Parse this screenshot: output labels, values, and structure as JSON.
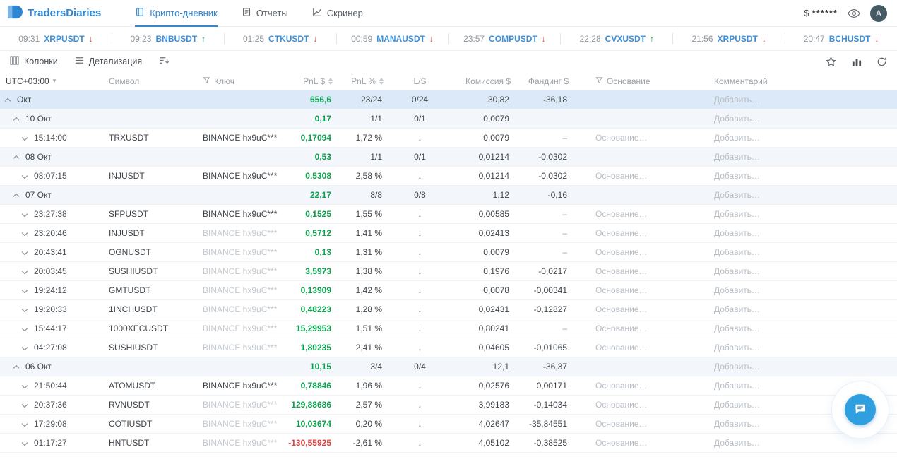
{
  "app": {
    "title": "TradersDiaries",
    "balance_currency": "$",
    "balance_masked": "******",
    "avatar_initial": "A"
  },
  "nav": {
    "tabs": [
      {
        "label": "Крипто-дневник",
        "active": true
      },
      {
        "label": "Отчеты",
        "active": false
      },
      {
        "label": "Скринер",
        "active": false
      }
    ]
  },
  "ticker": {
    "items": [
      {
        "time": "09:31",
        "symbol": "XRPUSDT",
        "direction": "down"
      },
      {
        "time": "09:23",
        "symbol": "BNBUSDT",
        "direction": "up"
      },
      {
        "time": "01:25",
        "symbol": "CTKUSDT",
        "direction": "down"
      },
      {
        "time": "00:59",
        "symbol": "MANAUSDT",
        "direction": "down"
      },
      {
        "time": "23:57",
        "symbol": "COMPUSDT",
        "direction": "down"
      },
      {
        "time": "22:28",
        "symbol": "CVXUSDT",
        "direction": "up"
      },
      {
        "time": "21:56",
        "symbol": "XRPUSDT",
        "direction": "down"
      },
      {
        "time": "20:47",
        "symbol": "BCHUSDT",
        "direction": "down"
      }
    ]
  },
  "toolbar": {
    "columns": "Колонки",
    "details": "Детализация"
  },
  "table": {
    "headers": {
      "time": "UTC+03:00",
      "symbol": "Символ",
      "key": "Ключ",
      "pnl_usd": "PnL $",
      "pnl_pct": "PnL %",
      "ls": "L/S",
      "fee": "Комиссия $",
      "funding": "Фандинг $",
      "basis": "Основание",
      "comment": "Комментарий"
    },
    "placeholders": {
      "basis": "Основание…",
      "comment": "Добавить…"
    },
    "rows": [
      {
        "kind": "month",
        "label": "Окт",
        "pnl": "656,6",
        "stat": "23/24",
        "ls": "0/24",
        "fee": "30,82",
        "funding": "-36,18"
      },
      {
        "kind": "date",
        "label": "10 Окт",
        "pnl": "0,17",
        "stat": "1/1",
        "ls": "0/1",
        "fee": "0,0079",
        "funding": ""
      },
      {
        "kind": "trade",
        "time": "15:14:00",
        "symbol": "TRXUSDT",
        "key": "BINANCE hx9uC***",
        "key_muted": false,
        "pnl": "0,17094",
        "pnl_neg": false,
        "pct": "1,72 %",
        "ls": "short",
        "fee": "0,0079",
        "funding": "–"
      },
      {
        "kind": "date",
        "label": "08 Окт",
        "pnl": "0,53",
        "stat": "1/1",
        "ls": "0/1",
        "fee": "0,01214",
        "funding": "-0,0302"
      },
      {
        "kind": "trade",
        "time": "08:07:15",
        "symbol": "INJUSDT",
        "key": "BINANCE hx9uC***",
        "key_muted": false,
        "pnl": "0,5308",
        "pnl_neg": false,
        "pct": "2,58 %",
        "ls": "short",
        "fee": "0,01214",
        "funding": "-0,0302"
      },
      {
        "kind": "date",
        "label": "07 Окт",
        "pnl": "22,17",
        "stat": "8/8",
        "ls": "0/8",
        "fee": "1,12",
        "funding": "-0,16"
      },
      {
        "kind": "trade",
        "time": "23:27:38",
        "symbol": "SFPUSDT",
        "key": "BINANCE hx9uC***",
        "key_muted": false,
        "pnl": "0,1525",
        "pnl_neg": false,
        "pct": "1,55 %",
        "ls": "short",
        "fee": "0,00585",
        "funding": "–"
      },
      {
        "kind": "trade",
        "time": "23:20:46",
        "symbol": "INJUSDT",
        "key": "BINANCE hx9uC***",
        "key_muted": true,
        "pnl": "0,5712",
        "pnl_neg": false,
        "pct": "1,41 %",
        "ls": "short",
        "fee": "0,02413",
        "funding": "–"
      },
      {
        "kind": "trade",
        "time": "20:43:41",
        "symbol": "OGNUSDT",
        "key": "BINANCE hx9uC***",
        "key_muted": true,
        "pnl": "0,13",
        "pnl_neg": false,
        "pct": "1,31 %",
        "ls": "short",
        "fee": "0,0079",
        "funding": "–"
      },
      {
        "kind": "trade",
        "time": "20:03:45",
        "symbol": "SUSHIUSDT",
        "key": "BINANCE hx9uC***",
        "key_muted": true,
        "pnl": "3,5973",
        "pnl_neg": false,
        "pct": "1,38 %",
        "ls": "short",
        "fee": "0,1976",
        "funding": "-0,0217"
      },
      {
        "kind": "trade",
        "time": "19:24:12",
        "symbol": "GMTUSDT",
        "key": "BINANCE hx9uC***",
        "key_muted": true,
        "pnl": "0,13909",
        "pnl_neg": false,
        "pct": "1,42 %",
        "ls": "short",
        "fee": "0,0078",
        "funding": "-0,00341"
      },
      {
        "kind": "trade",
        "time": "19:20:33",
        "symbol": "1INCHUSDT",
        "key": "BINANCE hx9uC***",
        "key_muted": true,
        "pnl": "0,48223",
        "pnl_neg": false,
        "pct": "1,28 %",
        "ls": "short",
        "fee": "0,02431",
        "funding": "-0,12827"
      },
      {
        "kind": "trade",
        "time": "15:44:17",
        "symbol": "1000XECUSDT",
        "key": "BINANCE hx9uC***",
        "key_muted": true,
        "pnl": "15,29953",
        "pnl_neg": false,
        "pct": "1,51 %",
        "ls": "short",
        "fee": "0,80241",
        "funding": "–"
      },
      {
        "kind": "trade",
        "time": "04:27:08",
        "symbol": "SUSHIUSDT",
        "key": "BINANCE hx9uC***",
        "key_muted": true,
        "pnl": "1,80235",
        "pnl_neg": false,
        "pct": "2,41 %",
        "ls": "short",
        "fee": "0,04605",
        "funding": "-0,01065"
      },
      {
        "kind": "date",
        "label": "06 Окт",
        "pnl": "10,15",
        "stat": "3/4",
        "ls": "0/4",
        "fee": "12,1",
        "funding": "-36,37"
      },
      {
        "kind": "trade",
        "time": "21:50:44",
        "symbol": "ATOMUSDT",
        "key": "BINANCE hx9uC***",
        "key_muted": false,
        "pnl": "0,78846",
        "pnl_neg": false,
        "pct": "1,96 %",
        "ls": "short",
        "fee": "0,02576",
        "funding": "0,00171"
      },
      {
        "kind": "trade",
        "time": "20:37:36",
        "symbol": "RVNUSDT",
        "key": "BINANCE hx9uC***",
        "key_muted": true,
        "pnl": "129,88686",
        "pnl_neg": false,
        "pct": "2,57 %",
        "ls": "short",
        "fee": "3,99183",
        "funding": "-0,14034"
      },
      {
        "kind": "trade",
        "time": "17:29:08",
        "symbol": "COTIUSDT",
        "key": "BINANCE hx9uC***",
        "key_muted": true,
        "pnl": "10,03674",
        "pnl_neg": false,
        "pct": "0,20 %",
        "ls": "short",
        "fee": "4,02647",
        "funding": "-35,84551"
      },
      {
        "kind": "trade",
        "time": "01:17:27",
        "symbol": "HNTUSDT",
        "key": "BINANCE hx9uC***",
        "key_muted": true,
        "pnl": "-130,55925",
        "pnl_neg": true,
        "pct": "-2,61 %",
        "ls": "short",
        "fee": "4,05102",
        "funding": "-0,38525"
      }
    ]
  },
  "colors": {
    "accent_blue": "#2f86d2",
    "positive_green": "#0da04f",
    "negative_red": "#e03e3e",
    "month_row_bg": "#dce9f8",
    "date_row_bg": "#f3f7fb"
  }
}
